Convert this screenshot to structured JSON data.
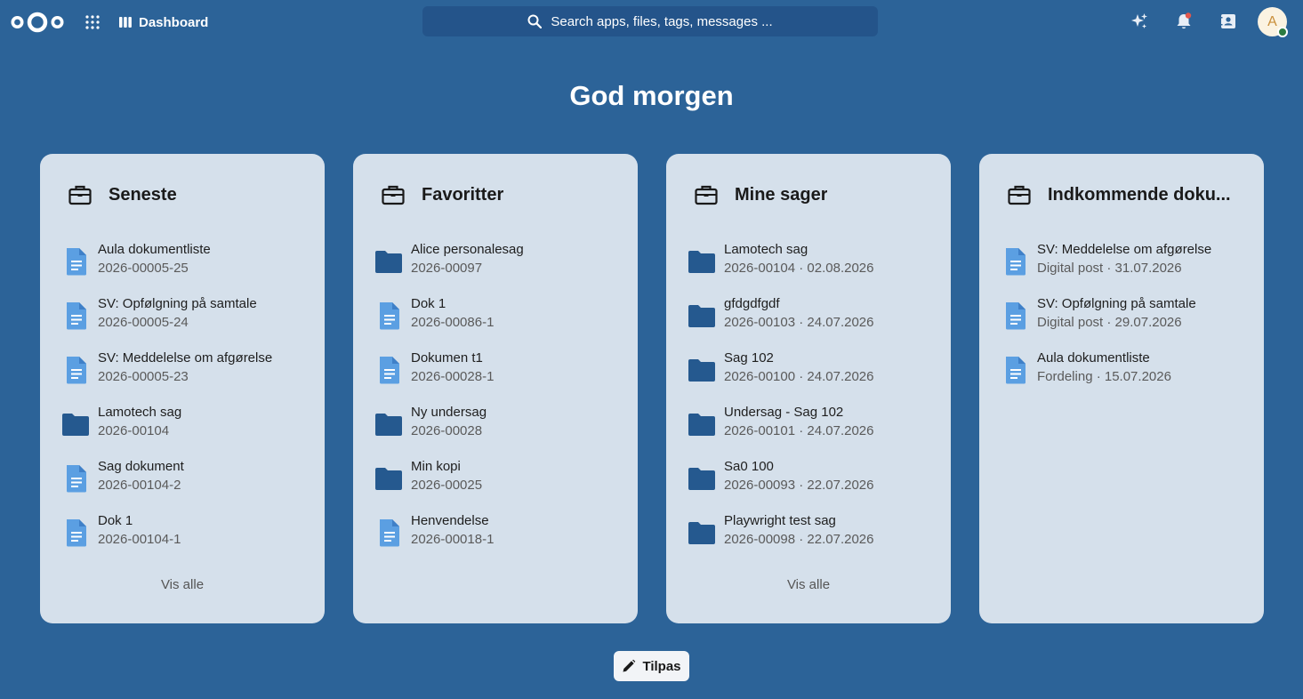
{
  "header": {
    "app_name": "Dashboard",
    "search_placeholder": "Search apps, files, tags, messages ...",
    "avatar_letter": "A"
  },
  "greeting": "God morgen",
  "panels": [
    {
      "title": "Seneste",
      "footer": "Vis alle",
      "items": [
        {
          "type": "doc",
          "title": "Aula dokumentliste",
          "sub": "2026-00005-25"
        },
        {
          "type": "doc",
          "title": "SV: Opfølgning på samtale",
          "sub": "2026-00005-24"
        },
        {
          "type": "doc",
          "title": "SV: Meddelelse om afgørelse",
          "sub": "2026-00005-23"
        },
        {
          "type": "folder",
          "title": "Lamotech sag",
          "sub": "2026-00104"
        },
        {
          "type": "doc",
          "title": "Sag dokument",
          "sub": "2026-00104-2"
        },
        {
          "type": "doc",
          "title": "Dok 1",
          "sub": "2026-00104-1"
        }
      ]
    },
    {
      "title": "Favoritter",
      "footer": "",
      "items": [
        {
          "type": "folder",
          "title": "Alice personalesag",
          "sub": "2026-00097"
        },
        {
          "type": "doc",
          "title": "Dok 1",
          "sub": "2026-00086-1"
        },
        {
          "type": "doc",
          "title": "Dokumen t1",
          "sub": "2026-00028-1"
        },
        {
          "type": "folder",
          "title": "Ny undersag",
          "sub": "2026-00028"
        },
        {
          "type": "folder",
          "title": "Min kopi",
          "sub": "2026-00025"
        },
        {
          "type": "doc",
          "title": "Henvendelse",
          "sub": "2026-00018-1"
        }
      ]
    },
    {
      "title": "Mine sager",
      "footer": "Vis alle",
      "items": [
        {
          "type": "folder",
          "title": "Lamotech sag",
          "sub": "2026-00104 · 02.08.2026"
        },
        {
          "type": "folder",
          "title": "gfdgdfgdf",
          "sub": "2026-00103 · 24.07.2026"
        },
        {
          "type": "folder",
          "title": "Sag 102",
          "sub": "2026-00100 · 24.07.2026"
        },
        {
          "type": "folder",
          "title": "Undersag - Sag 102",
          "sub": "2026-00101 · 24.07.2026"
        },
        {
          "type": "folder",
          "title": "Sa0 100",
          "sub": "2026-00093 · 22.07.2026"
        },
        {
          "type": "folder",
          "title": "Playwright test sag",
          "sub": "2026-00098 · 22.07.2026"
        }
      ]
    },
    {
      "title": "Indkommende doku...",
      "footer": "",
      "items": [
        {
          "type": "doc",
          "title": "SV: Meddelelse om afgørelse",
          "sub": "Digital post · 31.07.2026"
        },
        {
          "type": "doc",
          "title": "SV: Opfølgning på samtale",
          "sub": "Digital post · 29.07.2026"
        },
        {
          "type": "doc",
          "title": "Aula dokumentliste",
          "sub": "Fordeling · 15.07.2026"
        }
      ]
    }
  ],
  "customize_label": "Tilpas",
  "colors": {
    "background": "#2c6398",
    "panel": "#d5e0eb",
    "doc_icon": "#5b9fe2",
    "folder_icon": "#25598f"
  }
}
